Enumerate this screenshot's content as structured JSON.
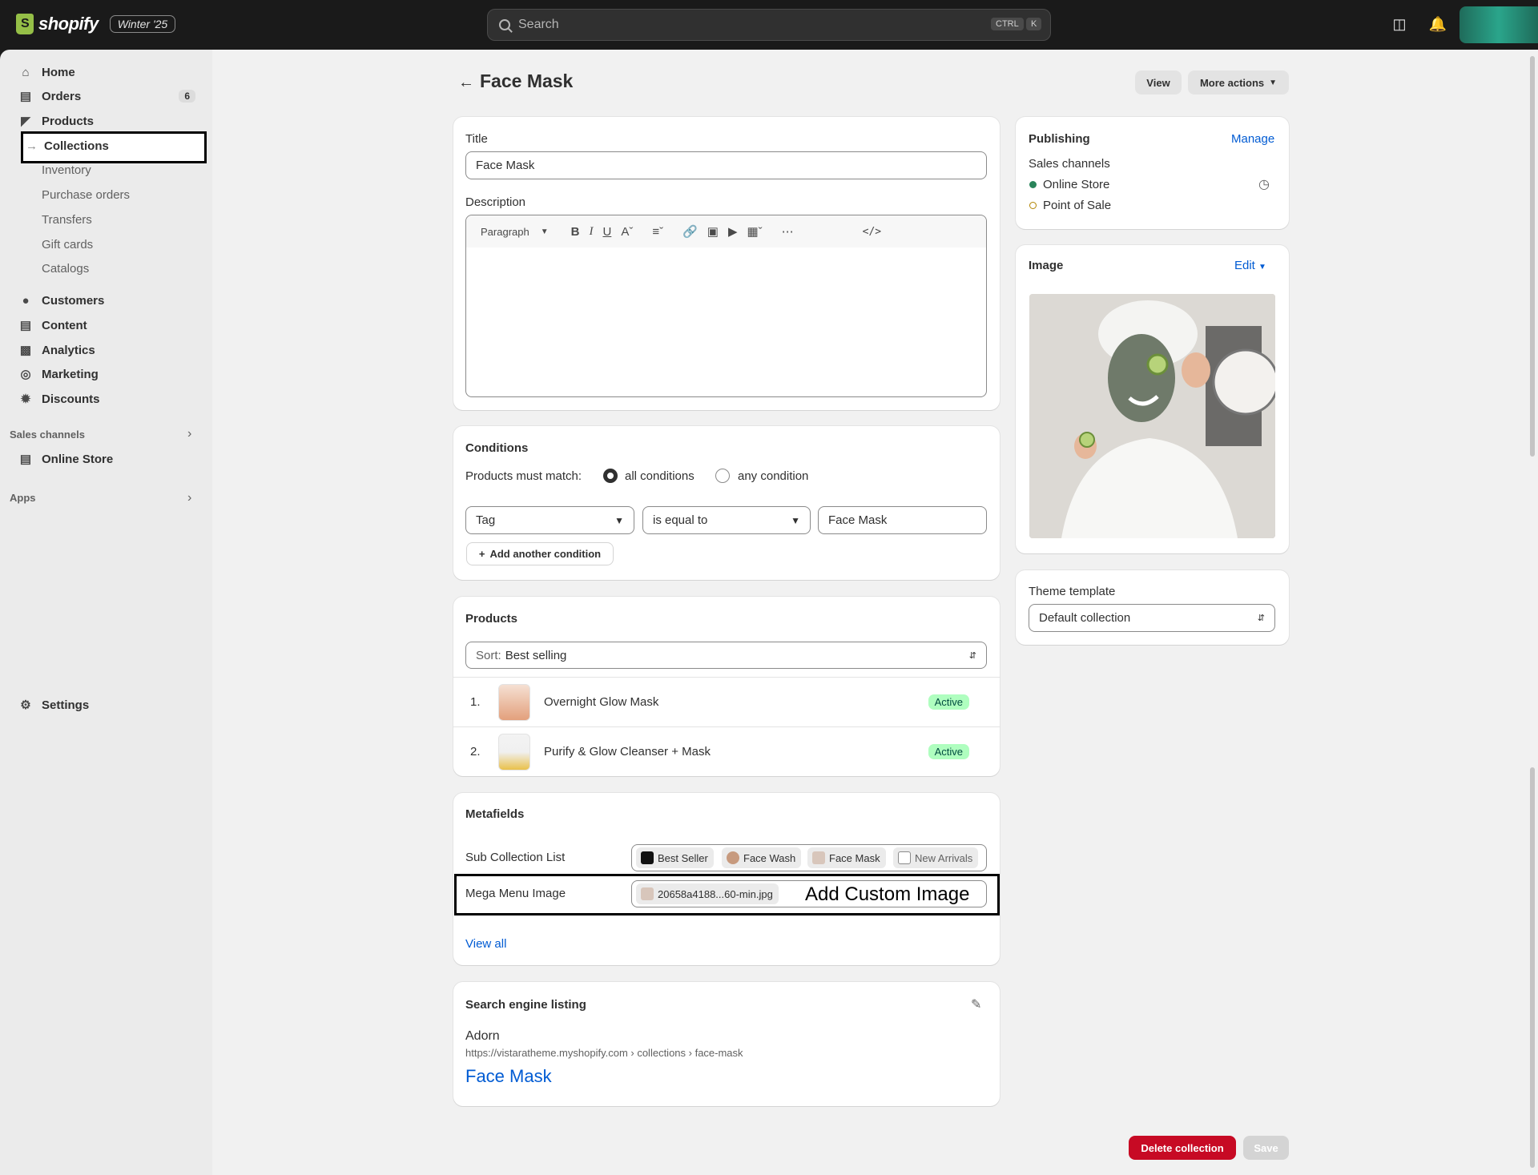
{
  "topbar": {
    "brand": "shopify",
    "edition": "Winter '25",
    "search_placeholder": "Search",
    "shortcut_ctrl": "CTRL",
    "shortcut_key": "K"
  },
  "sidebar": {
    "home": "Home",
    "orders": "Orders",
    "orders_count": "6",
    "products": "Products",
    "collections": "Collections",
    "inventory": "Inventory",
    "purchase_orders": "Purchase orders",
    "transfers": "Transfers",
    "gift_cards": "Gift cards",
    "catalogs": "Catalogs",
    "customers": "Customers",
    "content": "Content",
    "analytics": "Analytics",
    "marketing": "Marketing",
    "discounts": "Discounts",
    "sales_channels": "Sales channels",
    "online_store": "Online Store",
    "apps": "Apps",
    "settings": "Settings"
  },
  "header": {
    "title": "Face Mask",
    "view": "View",
    "more_actions": "More actions"
  },
  "general": {
    "title_label": "Title",
    "title_value": "Face Mask",
    "description_label": "Description",
    "paragraph": "Paragraph"
  },
  "conditions": {
    "heading": "Conditions",
    "match_label": "Products must match:",
    "all": "all conditions",
    "any": "any condition",
    "field": "Tag",
    "operator": "is equal to",
    "value": "Face Mask",
    "add": "Add another condition"
  },
  "products": {
    "heading": "Products",
    "sort_label": "Sort:",
    "sort_value": "Best selling",
    "items": [
      {
        "num": "1.",
        "name": "Overnight Glow Mask",
        "status": "Active"
      },
      {
        "num": "2.",
        "name": "Purify & Glow Cleanser + Mask",
        "status": "Active"
      }
    ]
  },
  "metafields": {
    "heading": "Metafields",
    "sub_label": "Sub Collection List",
    "chips": [
      "Best Seller",
      "Face Wash",
      "Face Mask",
      "New Arrivals"
    ],
    "mega_label": "Mega Menu Image",
    "file": "20658a4188...60-min.jpg",
    "annotation": "Add Custom Image",
    "view_all": "View all"
  },
  "seo": {
    "heading": "Search engine listing",
    "store": "Adorn",
    "url": "https://vistaratheme.myshopify.com › collections › face-mask",
    "title": "Face Mask"
  },
  "publishing": {
    "heading": "Publishing",
    "manage": "Manage",
    "channels_label": "Sales channels",
    "online": "Online Store",
    "pos": "Point of Sale"
  },
  "image_card": {
    "heading": "Image",
    "edit": "Edit"
  },
  "theme": {
    "label": "Theme template",
    "value": "Default collection"
  },
  "footer": {
    "delete": "Delete collection",
    "save": "Save"
  },
  "colors": {
    "accent": "#005bd3",
    "danger": "#c70a24",
    "active_bg": "#affebf"
  }
}
